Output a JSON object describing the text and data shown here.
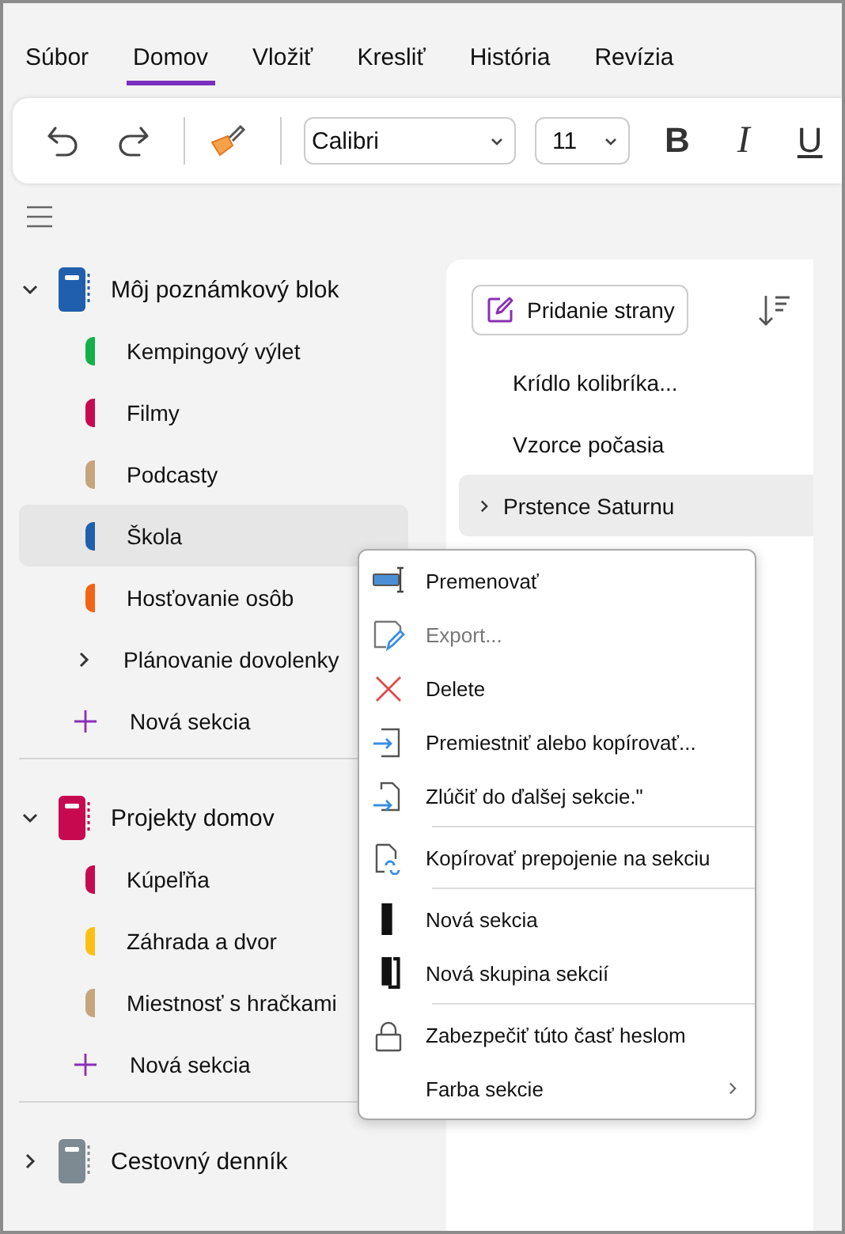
{
  "tabs": [
    {
      "label": "Súbor",
      "selected": false
    },
    {
      "label": "Domov",
      "selected": true
    },
    {
      "label": "Vložiť",
      "selected": false
    },
    {
      "label": "Kresliť",
      "selected": false
    },
    {
      "label": "História",
      "selected": false
    },
    {
      "label": "Revízia",
      "selected": false
    }
  ],
  "ribbon": {
    "font": "Calibri",
    "size": "11",
    "bold": "B",
    "italic": "I",
    "underline": "U"
  },
  "notebooks": [
    {
      "title": "Môj poznámkový blok",
      "color": "#1f5fae",
      "expanded": true,
      "sections": [
        {
          "kind": "section",
          "title": "Kempingový výlet",
          "color": "#13b148",
          "selected": false
        },
        {
          "kind": "section",
          "title": "Filmy",
          "color": "#c7094f",
          "selected": false
        },
        {
          "kind": "section",
          "title": "Podcasty",
          "color": "#c7a57c",
          "selected": false
        },
        {
          "kind": "section",
          "title": "Škola",
          "color": "#1f5fae",
          "selected": true
        },
        {
          "kind": "section",
          "title": "Hosťovanie osôb",
          "color": "#f06414",
          "selected": false
        },
        {
          "kind": "group",
          "title": "Plánovanie dovolenky",
          "expanded": false
        },
        {
          "kind": "new",
          "title": "Nová sekcia"
        }
      ]
    },
    {
      "title": "Projekty domov",
      "color": "#c7094f",
      "expanded": true,
      "sections": [
        {
          "kind": "section",
          "title": "Kúpeľňa",
          "color": "#c7094f",
          "selected": false
        },
        {
          "kind": "section",
          "title": "Záhrada a dvor",
          "color": "#fcc012",
          "selected": false
        },
        {
          "kind": "section",
          "title": "Miestnosť s hračkami",
          "color": "#c7a57c",
          "selected": false
        },
        {
          "kind": "new",
          "title": "Nová sekcia"
        }
      ]
    },
    {
      "title": "Cestovný denník",
      "color": "#7d8a91",
      "expanded": false
    }
  ],
  "pages": {
    "add_button": "Pridanie strany",
    "items": [
      {
        "title": "Krídlo kolibríka...",
        "selected": false,
        "collapsed": false
      },
      {
        "title": "Vzorce počasia",
        "selected": false,
        "collapsed": false
      },
      {
        "title": "Prstence Saturnu",
        "selected": true,
        "collapsed": true
      }
    ]
  },
  "context_menu": {
    "groups": [
      [
        {
          "kind": "rename",
          "label": "Premenovať",
          "disabled": false,
          "submenu": false
        },
        {
          "kind": "export",
          "label": "Export...",
          "disabled": true,
          "submenu": false
        },
        {
          "kind": "delete",
          "label": "Delete",
          "disabled": false,
          "submenu": false
        },
        {
          "kind": "move",
          "label": "Premiestniť alebo kopírovať...",
          "disabled": false,
          "submenu": false
        },
        {
          "kind": "merge",
          "label": "Zlúčiť do ďalšej sekcie.\"",
          "disabled": false,
          "submenu": false
        }
      ],
      [
        {
          "kind": "link",
          "label": "Kopírovať prepojenie na sekciu",
          "disabled": false,
          "submenu": false
        }
      ],
      [
        {
          "kind": "new-section",
          "label": "Nová sekcia",
          "disabled": false,
          "submenu": false
        },
        {
          "kind": "new-group",
          "label": "Nová skupina sekcií",
          "disabled": false,
          "submenu": false
        }
      ],
      [
        {
          "kind": "lock",
          "label": "Zabezpečiť túto časť heslom",
          "disabled": false,
          "submenu": false
        },
        {
          "kind": "color",
          "label": "Farba sekcie",
          "disabled": false,
          "submenu": true
        }
      ]
    ]
  }
}
